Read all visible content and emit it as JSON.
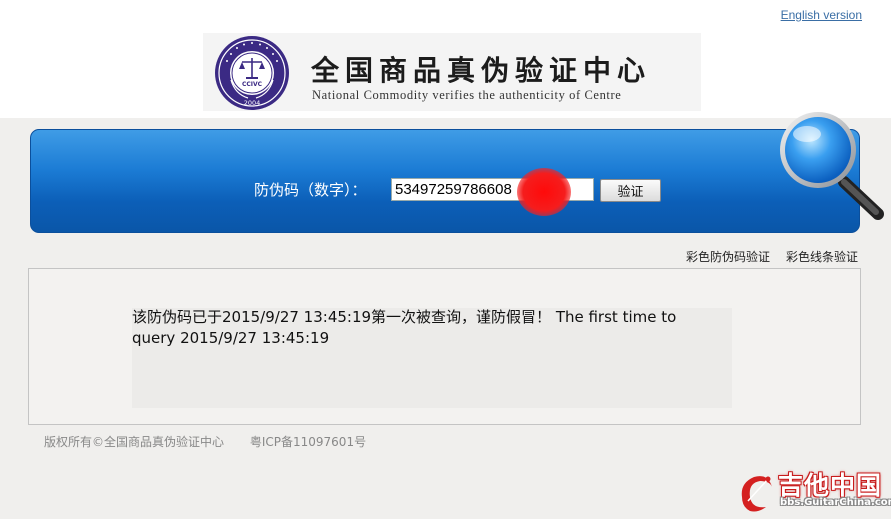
{
  "header": {
    "english_link": "English version",
    "title_cn": "全国商品真伪验证中心",
    "title_en": "National Commodity verifies the authenticity of Centre",
    "emblem_text": "CCIVC",
    "emblem_year": "2004"
  },
  "verify": {
    "label": "防伪码（数字）：",
    "code_value": "53497259786608",
    "button_label": "验证"
  },
  "sublinks": {
    "color_code": "彩色防伪码验证",
    "color_line": "彩色线条验证"
  },
  "result": {
    "message": "该防伪码已于2015/9/27 13:45:19第一次被查询，谨防假冒！ The first time to query 2015/9/27 13:45:19"
  },
  "footer": {
    "copyright": "版权所有©全国商品真伪验证中心",
    "icp": "粤ICP备11097601号"
  },
  "watermark": {
    "title": "吉他中国",
    "url": "bbs.GuitarChina.com"
  },
  "colors": {
    "panel_blue": "#1b7bd4",
    "link_blue": "#3a6ea5",
    "emblem_purple": "#3b2a84",
    "redaction_red": "#f51d1d"
  }
}
